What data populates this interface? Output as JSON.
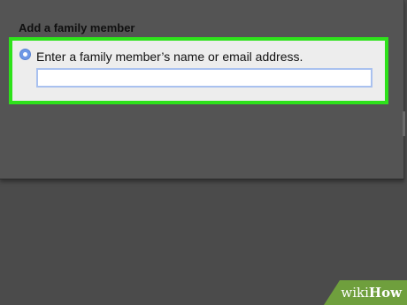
{
  "dialog": {
    "title": "Add a family member",
    "option": {
      "label": "Enter a family member’s name or email address.",
      "selected": true
    },
    "input": {
      "value": "",
      "placeholder": ""
    }
  },
  "watermark": {
    "prefix": "wiki",
    "suffix": "How"
  },
  "colors": {
    "highlight": "#2ee21b",
    "radio": "#6f98e6",
    "input_border": "#a9c1ef",
    "watermark_bg": "#6f9f3d"
  }
}
